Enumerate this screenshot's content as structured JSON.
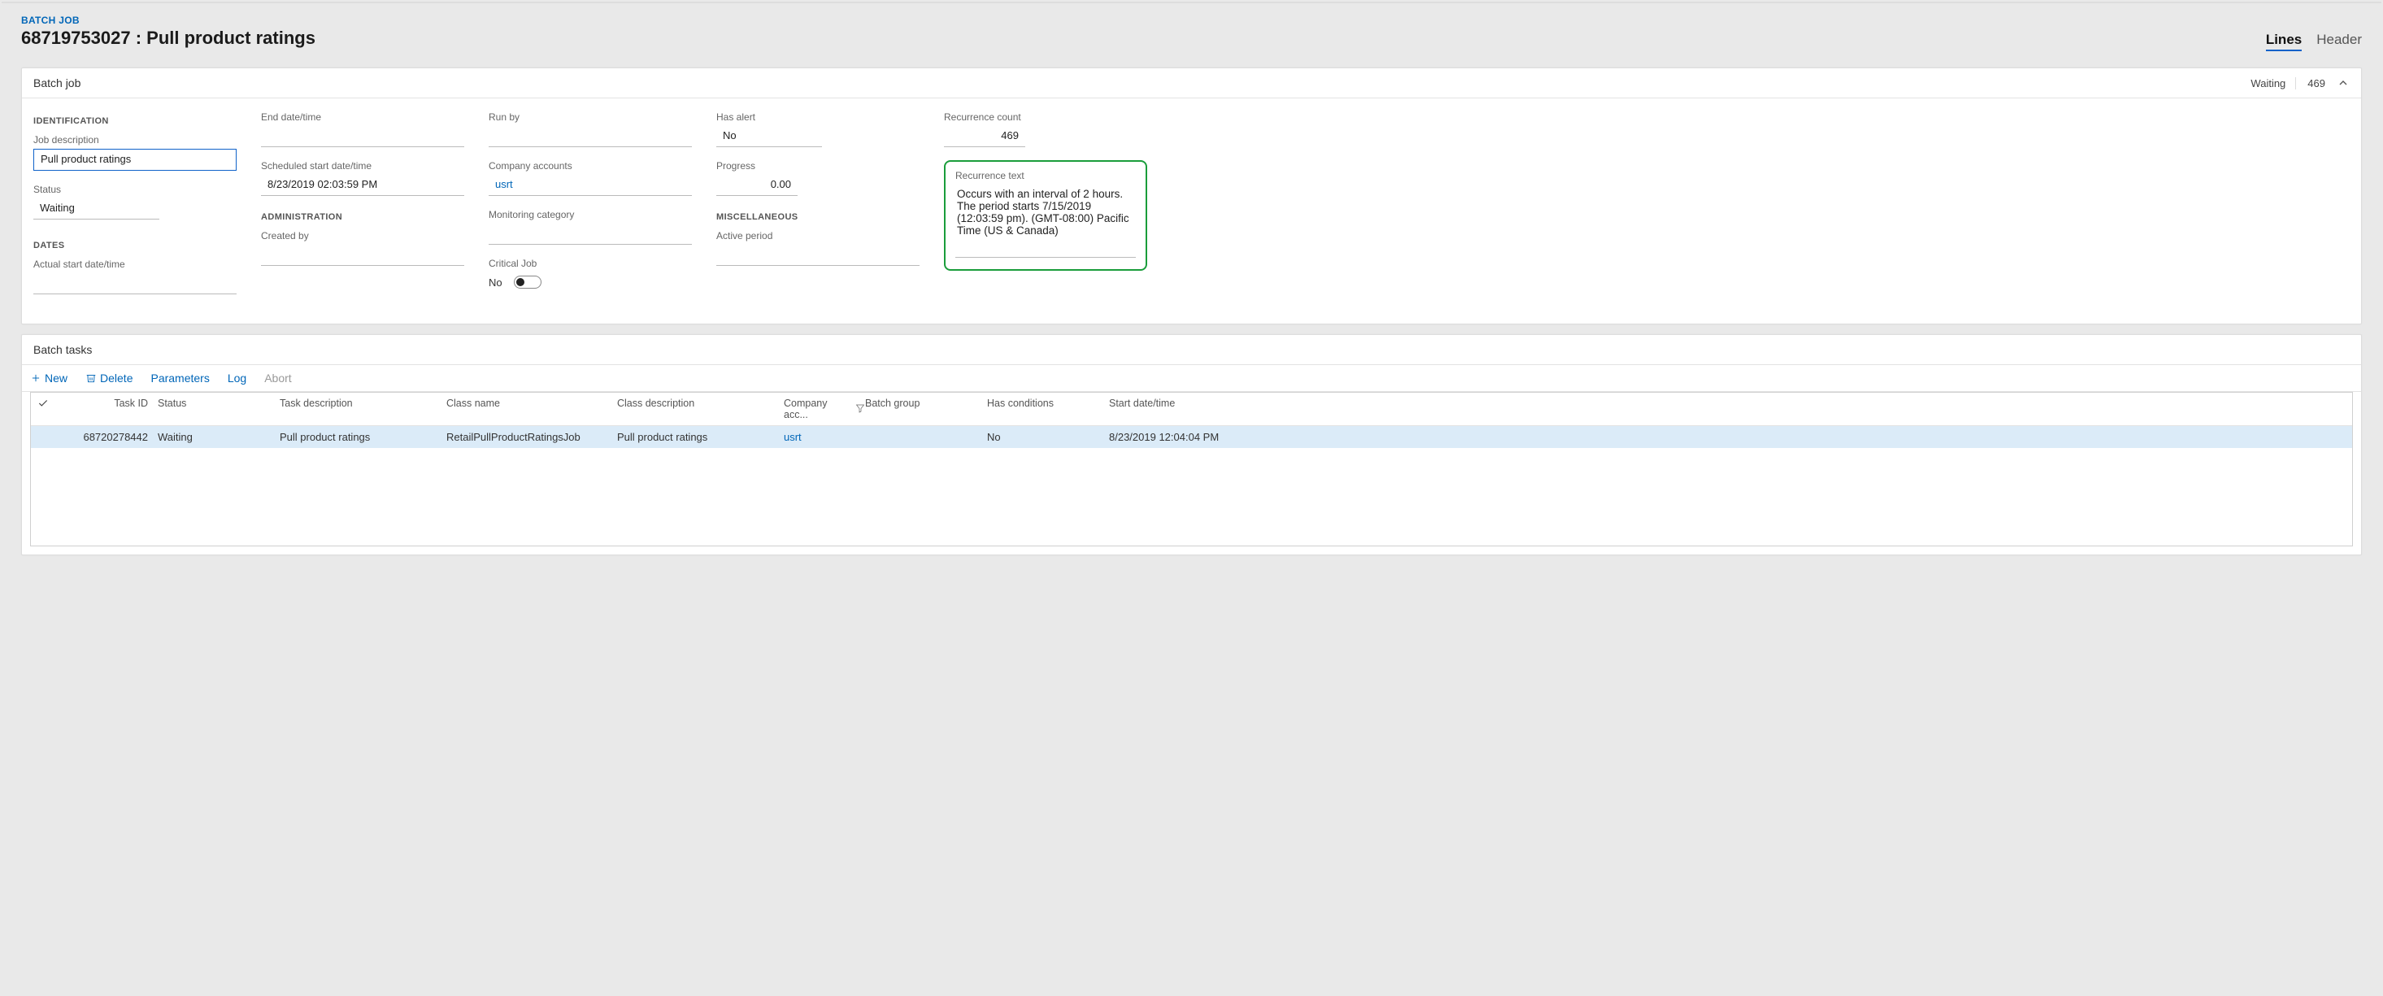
{
  "breadcrumb": "BATCH JOB",
  "page_title": "68719753027 : Pull product ratings",
  "tabs": {
    "lines": "Lines",
    "header": "Header"
  },
  "panel1": {
    "title": "Batch job",
    "status": "Waiting",
    "count": "469",
    "sections": {
      "identification": "IDENTIFICATION",
      "dates": "DATES",
      "administration": "ADMINISTRATION",
      "miscellaneous": "MISCELLANEOUS"
    },
    "labels": {
      "job_description": "Job description",
      "status": "Status",
      "actual_start": "Actual start date/time",
      "end": "End date/time",
      "sched_start": "Scheduled start date/time",
      "created_by": "Created by",
      "run_by": "Run by",
      "company_accounts": "Company accounts",
      "monitoring_category": "Monitoring category",
      "critical_job": "Critical Job",
      "has_alert": "Has alert",
      "progress": "Progress",
      "active_period": "Active period",
      "recurrence_count": "Recurrence count",
      "recurrence_text": "Recurrence text"
    },
    "values": {
      "job_description": "Pull product ratings",
      "status": "Waiting",
      "actual_start": "",
      "end": "",
      "sched_start": "8/23/2019 02:03:59 PM",
      "created_by": "",
      "run_by": "",
      "company_accounts": "usrt",
      "monitoring_category": "",
      "critical_job": "No",
      "has_alert": "No",
      "progress": "0.00",
      "active_period": "",
      "recurrence_count": "469",
      "recurrence_text": "Occurs with an interval of 2 hours. The period starts 7/15/2019 (12:03:59 pm). (GMT-08:00) Pacific Time (US & Canada)"
    }
  },
  "panel2": {
    "title": "Batch tasks",
    "toolbar": {
      "new": "New",
      "delete": "Delete",
      "parameters": "Parameters",
      "log": "Log",
      "abort": "Abort"
    },
    "columns": {
      "task_id": "Task ID",
      "status": "Status",
      "task_desc": "Task description",
      "class_name": "Class name",
      "class_desc": "Class description",
      "company": "Company acc...",
      "batch_group": "Batch group",
      "has_conditions": "Has conditions",
      "start": "Start date/time"
    },
    "row": {
      "task_id": "68720278442",
      "status": "Waiting",
      "task_desc": "Pull product ratings",
      "class_name": "RetailPullProductRatingsJob",
      "class_desc": "Pull product ratings",
      "company": "usrt",
      "batch_group": "",
      "has_conditions": "No",
      "start": "8/23/2019 12:04:04 PM"
    }
  }
}
